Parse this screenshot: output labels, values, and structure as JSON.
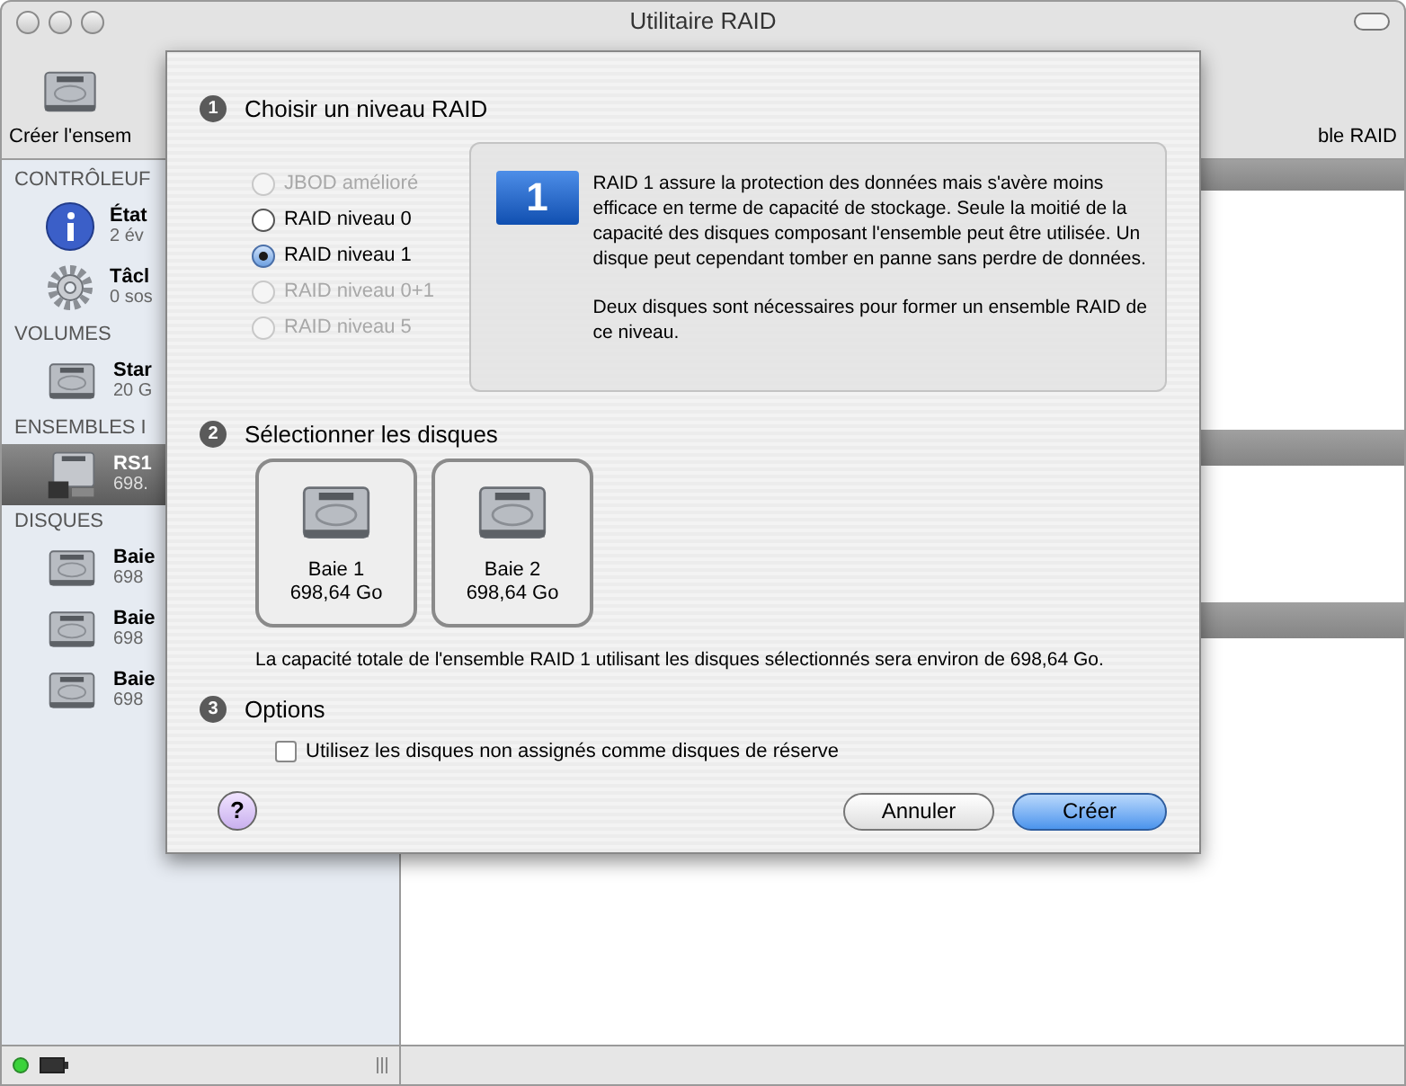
{
  "window": {
    "title": "Utilitaire RAID"
  },
  "toolbar": {
    "items": [
      {
        "kind": "create",
        "label": "Créer l'ensem"
      },
      {
        "kind": "plain",
        "label": "ble RAID"
      }
    ]
  },
  "sidebar": {
    "sections": [
      {
        "heading": "CONTRÔLEUF",
        "items": [
          {
            "kind": "info",
            "title": "État",
            "subtitle": "2 év",
            "selected": false
          },
          {
            "kind": "gear",
            "title": "Tâcl",
            "subtitle": "0 sos",
            "selected": false
          }
        ]
      },
      {
        "heading": "VOLUMES",
        "items": [
          {
            "kind": "disk",
            "title": "Star",
            "subtitle": "20 G",
            "selected": false
          }
        ]
      },
      {
        "heading": "ENSEMBLES I",
        "items": [
          {
            "kind": "raid",
            "title": "RS1",
            "subtitle": "698.",
            "selected": true
          }
        ]
      },
      {
        "heading": "DISQUES",
        "items": [
          {
            "kind": "disk",
            "title": "Baie",
            "subtitle": "698",
            "selected": false
          },
          {
            "kind": "disk",
            "title": "Baie",
            "subtitle": "698",
            "selected": false
          },
          {
            "kind": "disk",
            "title": "Baie",
            "subtitle": "698",
            "selected": false
          }
        ]
      }
    ]
  },
  "sheet": {
    "raid_level": {
      "number": "1",
      "heading": "Choisir un niveau RAID",
      "options": [
        {
          "label": "JBOD amélioré",
          "selected": false,
          "disabled": true
        },
        {
          "label": "RAID niveau 0",
          "selected": false,
          "disabled": false
        },
        {
          "label": "RAID niveau 1",
          "selected": true,
          "disabled": false
        },
        {
          "label": "RAID niveau 0+1",
          "selected": false,
          "disabled": true
        },
        {
          "label": "RAID niveau 5",
          "selected": false,
          "disabled": true
        }
      ],
      "info": {
        "badge": "1",
        "paragraphs": [
          "RAID 1 assure la protection des données mais s'avère moins efficace en terme de capacité de stockage. Seule la moitié de la capacité des disques composant l'ensemble peut être utilisée. Un disque peut cependant tomber en panne sans perdre de données.",
          "Deux disques sont nécessaires pour former un ensemble RAID de ce niveau."
        ]
      }
    },
    "disk_selection": {
      "number": "2",
      "heading": "Sélectionner les disques",
      "disks": [
        {
          "name": "Baie 1",
          "size": "698,64 Go"
        },
        {
          "name": "Baie 2",
          "size": "698,64 Go"
        }
      ],
      "summary": "La capacité totale de l'ensemble RAID 1 utilisant les disques sélectionnés sera environ de 698,64 Go."
    },
    "options": {
      "number": "3",
      "heading": "Options",
      "checkbox": {
        "label": "Utilisez les disques non assignés comme disques de réserve",
        "checked": false
      }
    },
    "buttons": {
      "help": "?",
      "cancel": "Annuler",
      "confirm": "Créer"
    }
  }
}
